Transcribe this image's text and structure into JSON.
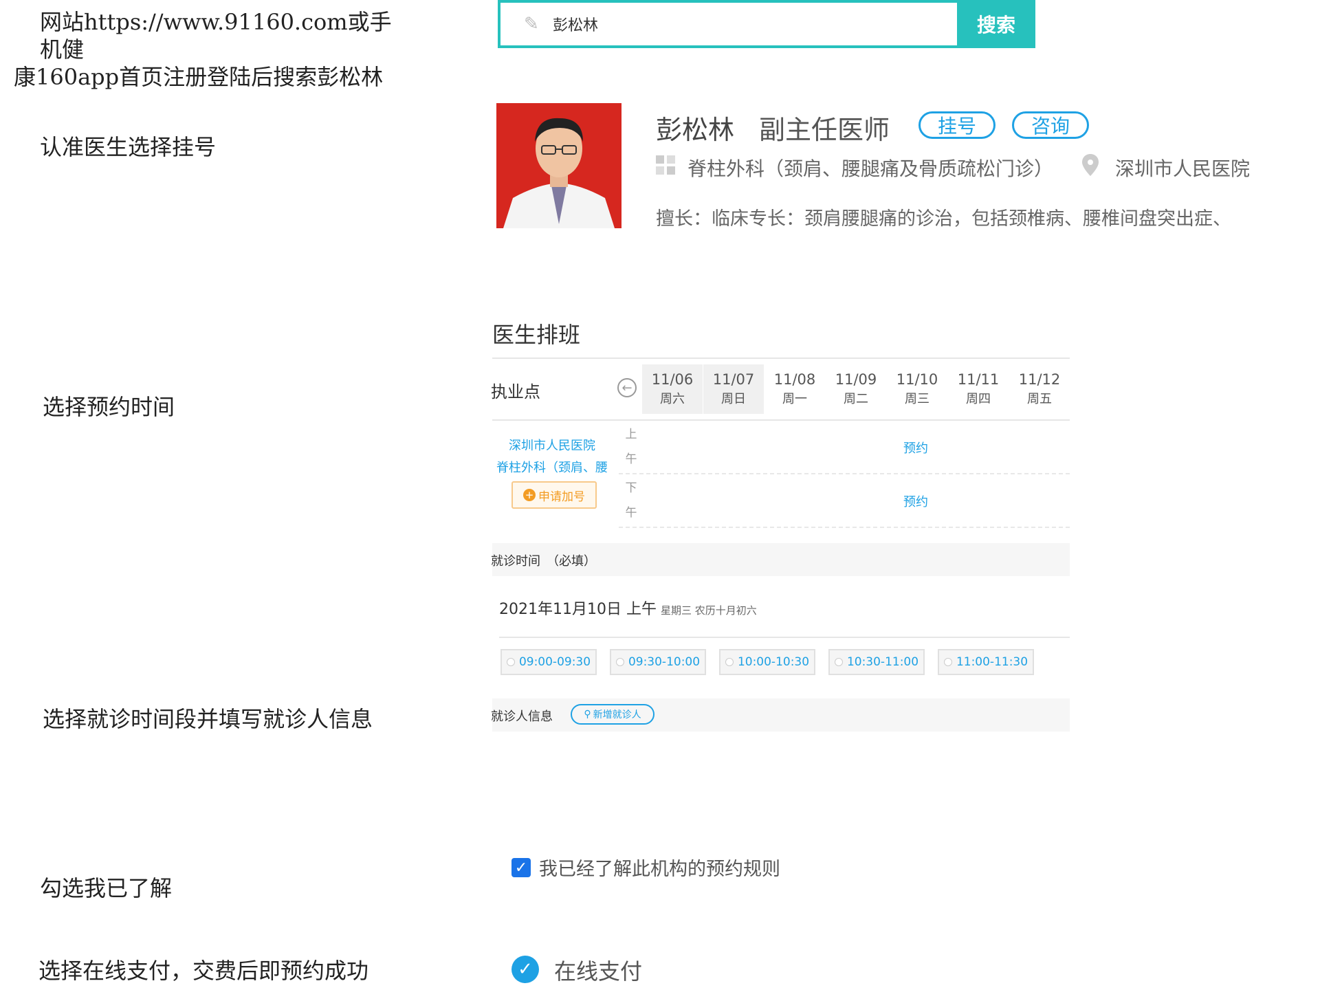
{
  "steps": {
    "intro_line1": "网站https://www.91160.com或手机健",
    "intro_line2": "康160app首页注册登陆后搜索彭松林",
    "step2": "认准医生选择挂号",
    "step3": "选择预约时间",
    "step4": "选择就诊时间段并填写就诊人信息",
    "step5": "勾选我已了解",
    "step6": "选择在线支付，交费后即预约成功"
  },
  "search": {
    "query": "彭松林",
    "button": "搜索",
    "accent": "#27c1bd"
  },
  "doctor": {
    "name": "彭松林",
    "title": "副主任医师",
    "register_label": "挂号",
    "consult_label": "咨询",
    "department": "脊柱外科（颈肩、腰腿痛及骨质疏松门诊）",
    "hospital": "深圳市人民医院",
    "specialty": "擅长：临床专长：颈肩腰腿痛的诊治，包括颈椎病、腰椎间盘突出症、"
  },
  "schedule": {
    "title": "医生排班",
    "site_label": "执业点",
    "days": [
      {
        "date": "11/06",
        "weekday": "周六"
      },
      {
        "date": "11/07",
        "weekday": "周日"
      },
      {
        "date": "11/08",
        "weekday": "周一"
      },
      {
        "date": "11/09",
        "weekday": "周二"
      },
      {
        "date": "11/10",
        "weekday": "周三"
      },
      {
        "date": "11/11",
        "weekday": "周四"
      },
      {
        "date": "11/12",
        "weekday": "周五"
      }
    ],
    "site_hospital": "深圳市人民医院",
    "site_department": "脊柱外科（颈肩、腰",
    "add_number": "申请加号",
    "morning": [
      "上",
      "午"
    ],
    "afternoon": [
      "下",
      "午"
    ],
    "book_label": "预约"
  },
  "visit": {
    "label": "就诊时间　（必填）",
    "date": "2021年11月10日 上午",
    "date_detail": "星期三 农历十月初六",
    "slots": [
      "09:00-09:30",
      "09:30-10:00",
      "10:00-10:30",
      "10:30-11:00",
      "11:00-11:30"
    ],
    "patient_label": "就诊人信息",
    "new_patient": "新增就诊人"
  },
  "agreement": {
    "text": "我已经了解此机构的预约规则"
  },
  "payment": {
    "text": "在线支付",
    "accent": "#1ea1e4"
  }
}
